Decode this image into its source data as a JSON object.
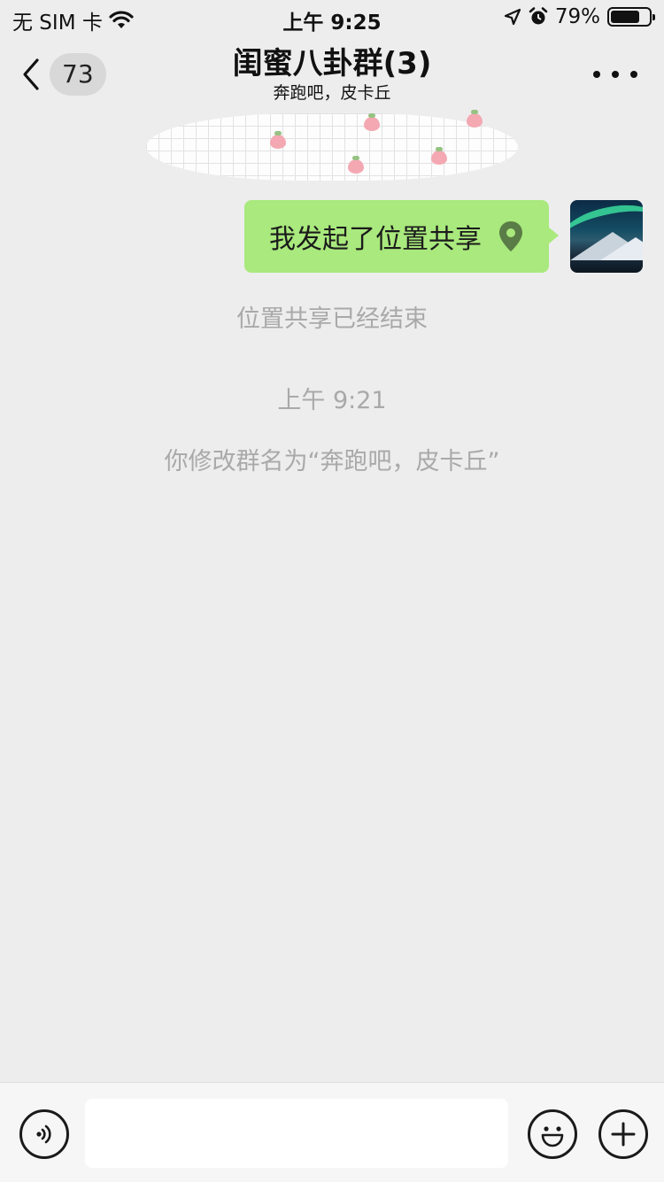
{
  "status_bar": {
    "carrier": "无 SIM 卡",
    "time": "上午 9:25",
    "battery": "79%",
    "battery_level": 0.79
  },
  "header": {
    "back_badge": "73",
    "title": "闺蜜八卦群(3)",
    "subtitle": "奔跑吧，皮卡丘"
  },
  "messages": {
    "location_share_text": "我发起了位置共享",
    "system_location_ended": "位置共享已经结束",
    "timestamp": "上午 9:21",
    "system_rename": "你修改群名为“奔跑吧，皮卡丘”"
  },
  "input_bar": {
    "placeholder": ""
  },
  "colors": {
    "bubble_green": "#a9e97d",
    "background": "#ededed",
    "location_pin": "#5a7c46"
  }
}
